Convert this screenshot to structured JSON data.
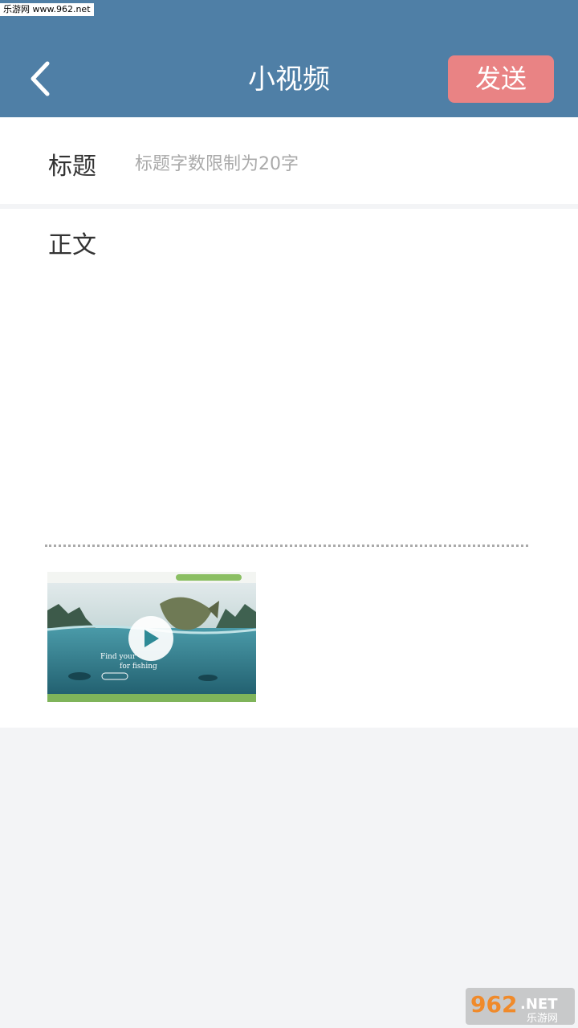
{
  "watermark_top": "乐游网 www.962.net",
  "header": {
    "title": "小视频",
    "send_label": "发送",
    "back_icon": "chevron-left-icon"
  },
  "form": {
    "title_label": "标题",
    "title_placeholder": "标题字数限制为20字",
    "body_label": "正文"
  },
  "video": {
    "caption_line1": "Find your",
    "caption_line2": "for fishing",
    "play_icon": "play-icon"
  },
  "watermark_bottom": {
    "brand": "962",
    "suffix": ".NET",
    "cn": "乐游网"
  },
  "colors": {
    "header_bg": "#4f7fa6",
    "send_bg": "#e98384",
    "page_bg": "#f3f4f6"
  }
}
